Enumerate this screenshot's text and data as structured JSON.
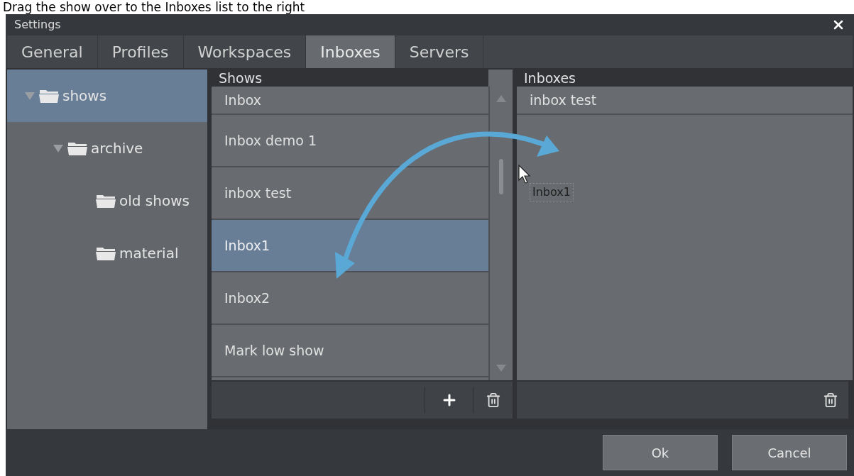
{
  "caption": "Drag the show over to the Inboxes list to the right",
  "window": {
    "title": "Settings"
  },
  "tabs": [
    {
      "label": "General",
      "selected": false
    },
    {
      "label": "Profiles",
      "selected": false
    },
    {
      "label": "Workspaces",
      "selected": false
    },
    {
      "label": "Inboxes",
      "selected": true
    },
    {
      "label": "Servers",
      "selected": false
    }
  ],
  "tree": [
    {
      "label": "shows",
      "selected": true,
      "expanded": true,
      "children": [
        {
          "label": "archive",
          "selected": false,
          "expanded": true,
          "children": [
            {
              "label": "old shows",
              "selected": false
            },
            {
              "label": "material",
              "selected": false
            }
          ]
        }
      ]
    }
  ],
  "shows": {
    "heading": "Shows",
    "items": [
      {
        "label": "Inbox",
        "selected": false
      },
      {
        "label": "Inbox demo 1",
        "selected": false
      },
      {
        "label": "inbox test",
        "selected": false
      },
      {
        "label": "Inbox1",
        "selected": true
      },
      {
        "label": "Inbox2",
        "selected": false
      },
      {
        "label": "Mark low show",
        "selected": false
      }
    ]
  },
  "inboxes": {
    "heading": "Inboxes",
    "items": [
      {
        "label": "inbox test",
        "selected": false
      }
    ]
  },
  "drag_ghost": "Inbox1",
  "buttons": [
    {
      "label": "Ok"
    },
    {
      "label": "Cancel"
    }
  ]
}
